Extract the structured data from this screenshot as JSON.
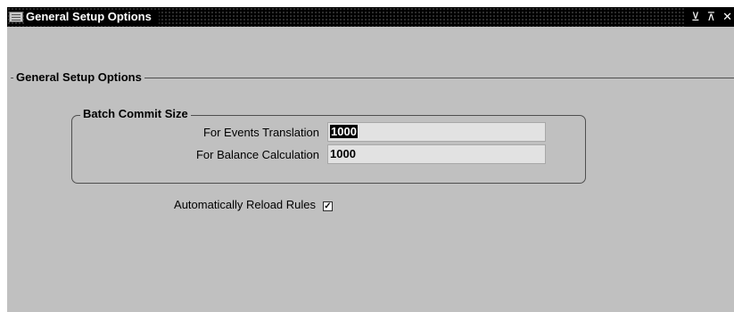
{
  "window": {
    "title": "General Setup Options",
    "buttons": {
      "minimize": "⊻",
      "maximize": "⊼",
      "close": "✕"
    }
  },
  "section": {
    "label": "General Setup Options"
  },
  "batch_commit": {
    "label": "Batch Commit Size",
    "fields": [
      {
        "label": "For Events Translation",
        "value": "1000"
      },
      {
        "label": "For Balance Calculation",
        "value": "1000"
      }
    ]
  },
  "reload_rules": {
    "label": "Automatically Reload Rules",
    "checked": true,
    "check_glyph": "✓"
  },
  "colors": {
    "window_bg": "#c0c0c0",
    "titlebar_bg": "#000000",
    "field_bg": "#e2e2e2"
  }
}
